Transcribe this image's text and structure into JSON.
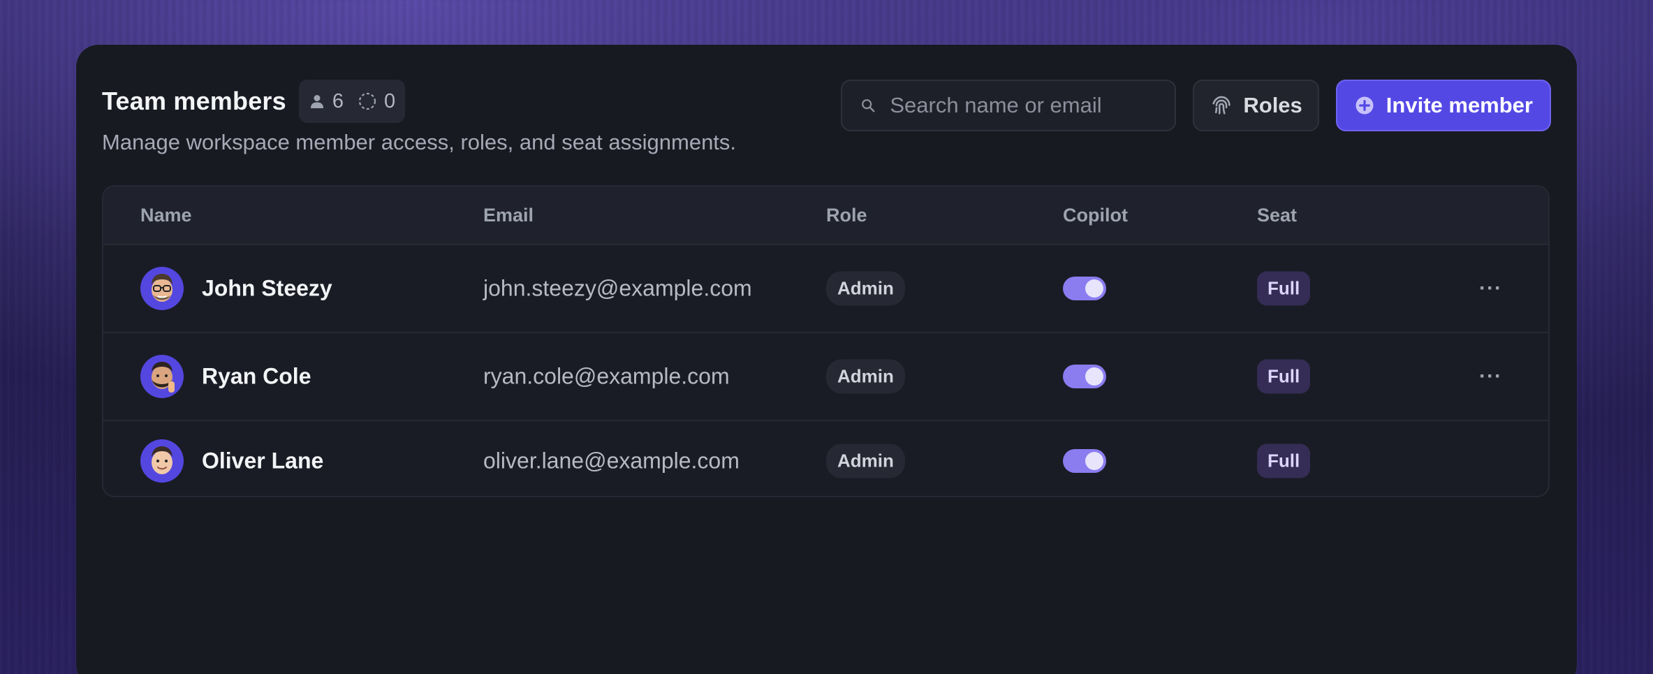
{
  "header": {
    "title": "Team members",
    "member_count": "6",
    "pending_count": "0",
    "subtitle": "Manage workspace member access, roles, and seat assignments.",
    "search_placeholder": "Search name or email",
    "roles_label": "Roles",
    "invite_label": "Invite member"
  },
  "table": {
    "columns": {
      "name": "Name",
      "email": "Email",
      "role": "Role",
      "copilot": "Copilot",
      "seat": "Seat"
    },
    "rows": [
      {
        "name": "John Steezy",
        "email": "john.steezy@example.com",
        "role": "Admin",
        "copilot": true,
        "seat": "Full",
        "menu": "···"
      },
      {
        "name": "Ryan Cole",
        "email": "ryan.cole@example.com",
        "role": "Admin",
        "copilot": true,
        "seat": "Full",
        "menu": "···"
      },
      {
        "name": "Oliver Lane",
        "email": "oliver.lane@example.com",
        "role": "Admin",
        "copilot": true,
        "seat": "Full",
        "menu": ""
      }
    ]
  },
  "colors": {
    "accent": "#5448e5",
    "toggle_on": "#8b7cf0",
    "card_bg": "#181a22"
  }
}
